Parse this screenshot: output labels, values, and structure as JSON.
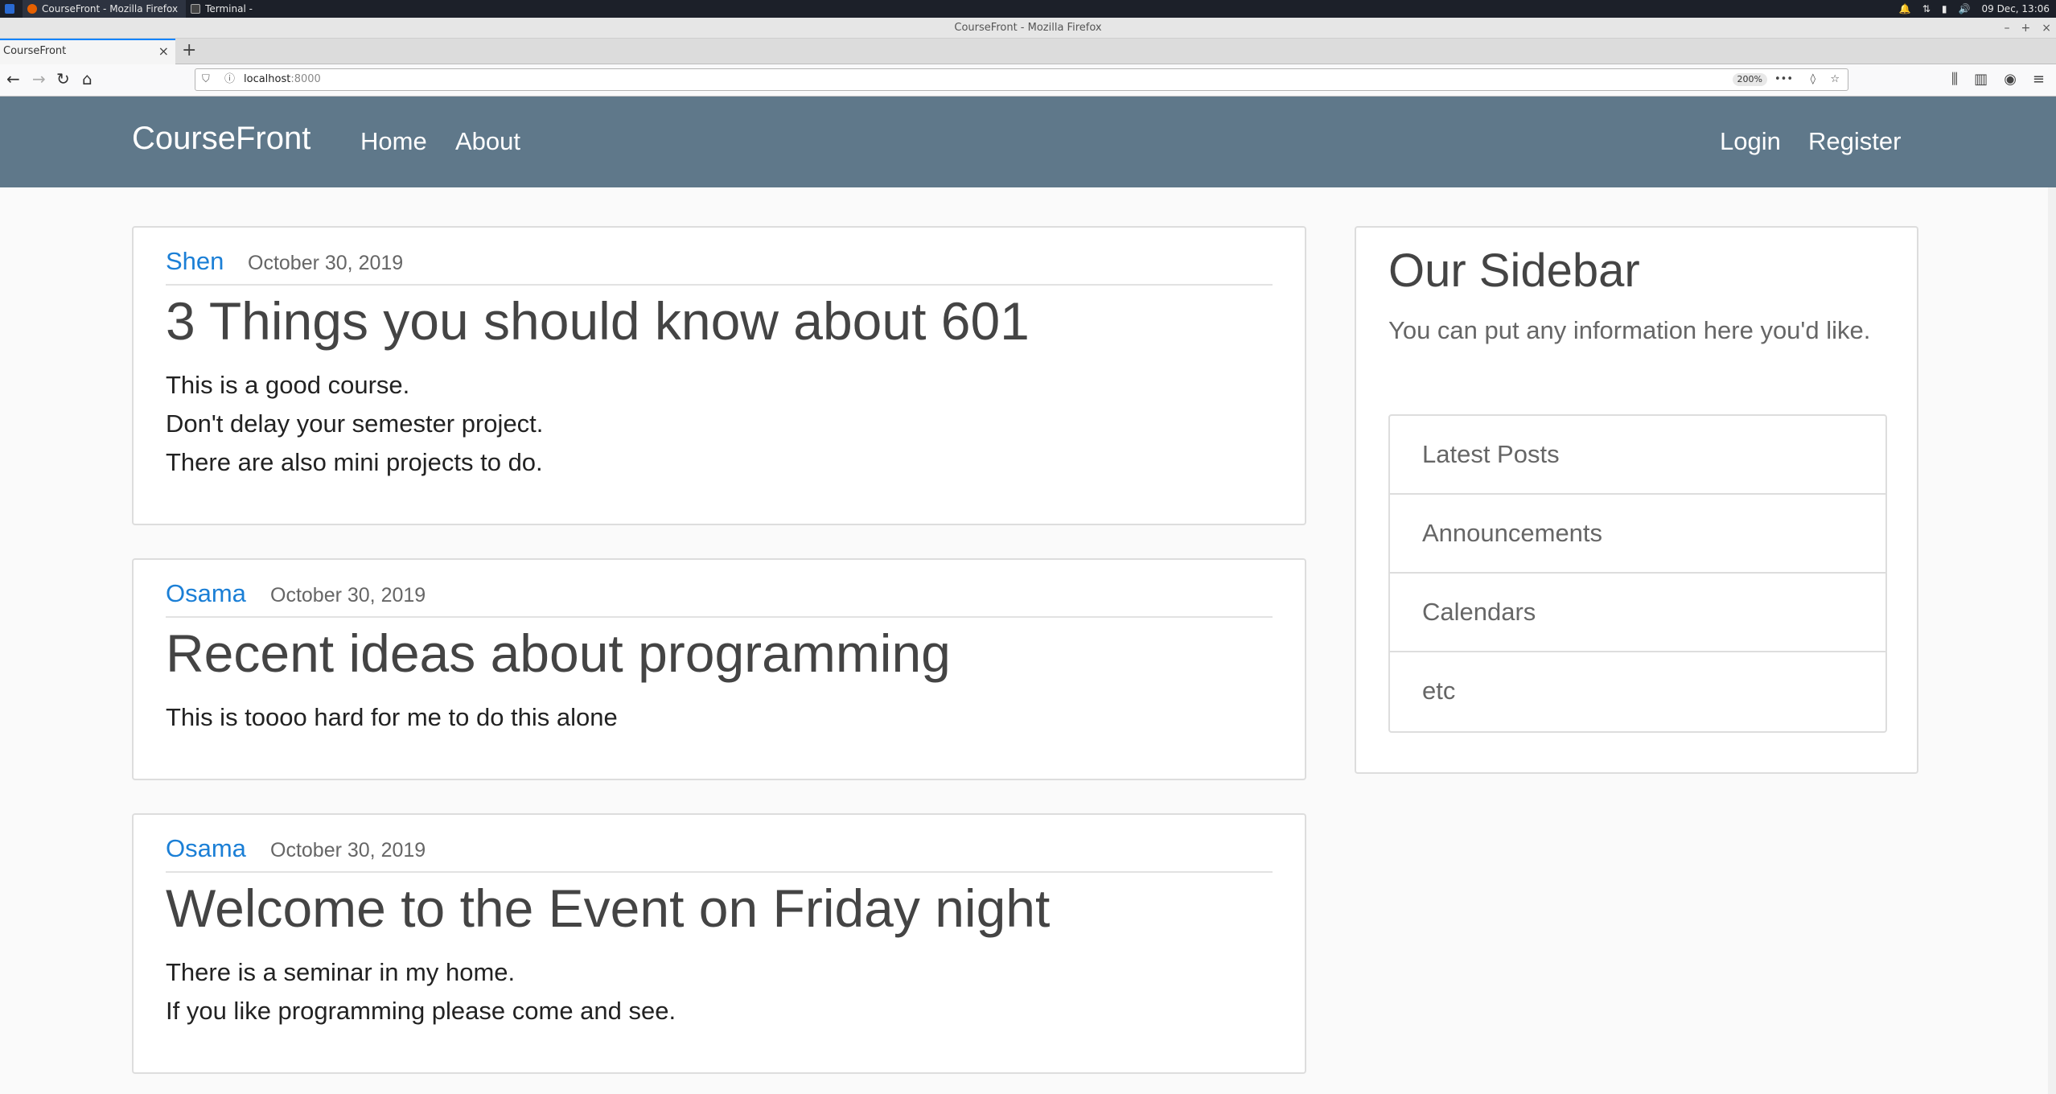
{
  "taskbar": {
    "items": [
      {
        "label": "CourseFront - Mozilla Firefox"
      },
      {
        "label": "Terminal -"
      }
    ],
    "clock": "09 Dec, 13:06"
  },
  "window": {
    "title": "CourseFront - Mozilla Firefox",
    "tab_title": "CourseFront",
    "url_host": "localhost",
    "url_port": ":8000",
    "zoom": "200%"
  },
  "site": {
    "brand": "CourseFront",
    "nav_left": [
      "Home",
      "About"
    ],
    "nav_right": [
      "Login",
      "Register"
    ]
  },
  "posts": [
    {
      "author": "Shen",
      "date": "October 30, 2019",
      "title": "3 Things you should know about 601",
      "lines": [
        "This is a good course.",
        "Don't delay your semester project.",
        "There are also mini projects to do."
      ]
    },
    {
      "author": "Osama",
      "date": "October 30, 2019",
      "title": "Recent ideas about programming",
      "lines": [
        "This is toooo hard for me to do this alone"
      ]
    },
    {
      "author": "Osama",
      "date": "October 30, 2019",
      "title": "Welcome to the Event on Friday night",
      "lines": [
        "There is a seminar in my home.",
        "If you like programming please come and see."
      ]
    }
  ],
  "sidebar": {
    "title": "Our Sidebar",
    "text": "You can put any information here you'd like.",
    "items": [
      "Latest Posts",
      "Announcements",
      "Calendars",
      "etc"
    ]
  },
  "colors": {
    "header_bg": "#5f788a",
    "author_link": "#1b7fd6",
    "tab_accent": "#0a84ff"
  }
}
